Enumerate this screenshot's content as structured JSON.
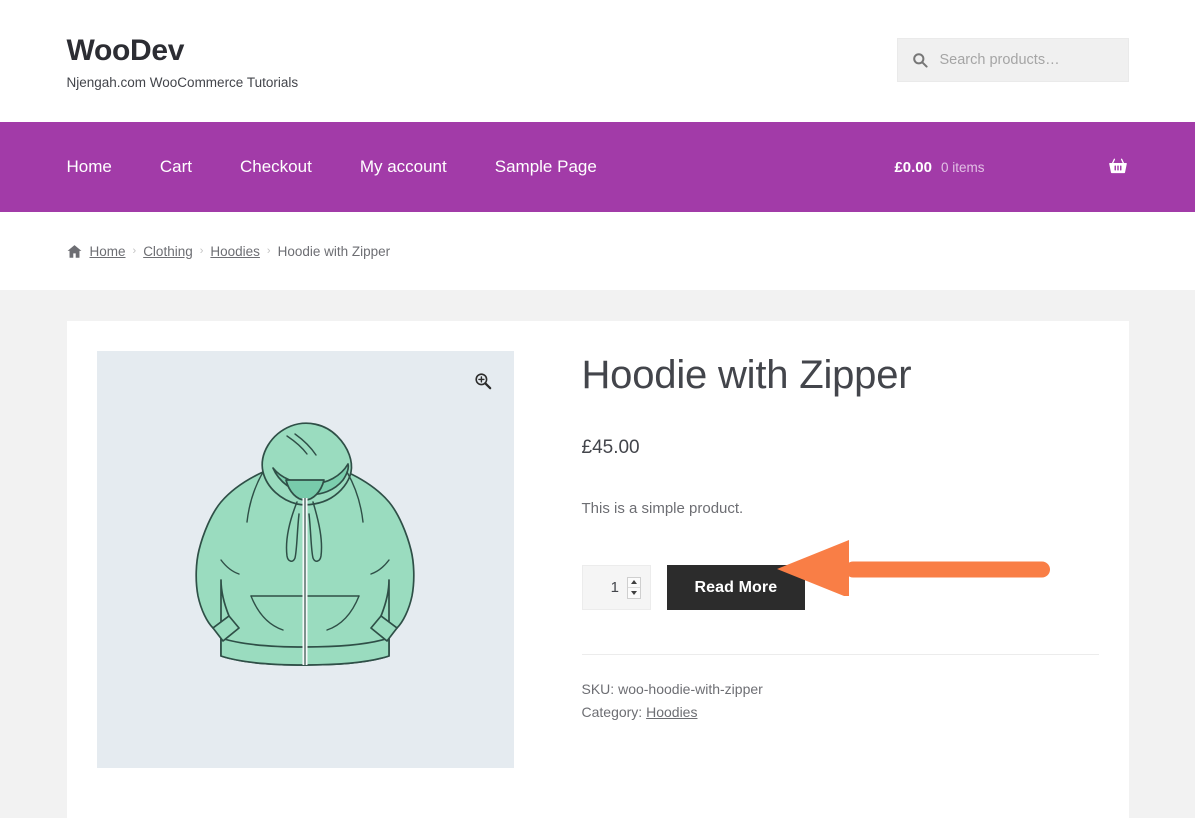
{
  "header": {
    "site_title": "WooDev",
    "tagline": "Njengah.com WooCommerce Tutorials",
    "search": {
      "placeholder": "Search products…",
      "value": "",
      "icon": "search-icon"
    }
  },
  "nav": {
    "items": [
      {
        "label": "Home"
      },
      {
        "label": "Cart"
      },
      {
        "label": "Checkout"
      },
      {
        "label": "My account"
      },
      {
        "label": "Sample Page"
      }
    ],
    "cart": {
      "amount": "£0.00",
      "count": "0 items",
      "icon": "shopping-basket-icon"
    },
    "background_color": "#a23ba8"
  },
  "breadcrumb": {
    "home_icon": "home-icon",
    "separator": "›",
    "items": [
      {
        "label": "Home",
        "is_link": true
      },
      {
        "label": "Clothing",
        "is_link": true
      },
      {
        "label": "Hoodies",
        "is_link": true
      },
      {
        "label": "Hoodie with Zipper",
        "is_link": false
      }
    ]
  },
  "product": {
    "title": "Hoodie with Zipper",
    "price": "£45.00",
    "description": "This is a simple product.",
    "quantity": "1",
    "add_to_cart_label": "Read More",
    "sku_label": "SKU:",
    "sku_value": "woo-hoodie-with-zipper",
    "category_label": "Category:",
    "category_value": "Hoodies",
    "gallery": {
      "zoom_icon": "magnify-plus-icon",
      "image_alt": "Mint green zip-up hoodie illustration",
      "image_background": "#e5ebf0",
      "garment_color": "#9adcbf"
    }
  },
  "annotation": {
    "arrow_color": "#f97e46",
    "points_to": "Read More"
  },
  "colors": {
    "page_background": "#f2f2f2",
    "card_background": "#ffffff",
    "accent_purple": "#a23ba8",
    "button_dark": "#2c2c2c",
    "text": "#43454b",
    "muted_text": "#6d6e73"
  }
}
